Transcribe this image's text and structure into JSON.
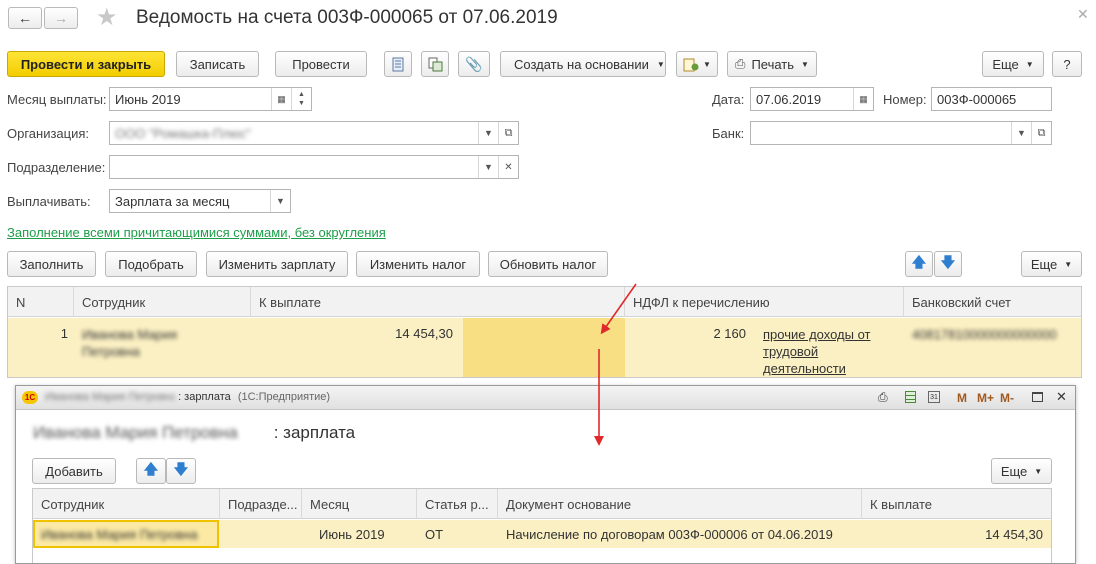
{
  "title": "Ведомость на счета 003Ф-000065 от 07.06.2019",
  "toolbar": {
    "post_close": "Провести и закрыть",
    "save": "Записать",
    "post": "Провести",
    "create_based": "Создать на основании",
    "print": "Печать",
    "more": "Еще",
    "help": "?"
  },
  "form": {
    "month_label": "Месяц выплаты:",
    "month_value": "Июнь 2019",
    "org_label": "Организация:",
    "org_value": "ООО \"Ромашка-Плюс\"",
    "dept_label": "Подразделение:",
    "dept_value": "",
    "pay_label": "Выплачивать:",
    "pay_value": "Зарплата за месяц",
    "date_label": "Дата:",
    "date_value": "07.06.2019",
    "number_label": "Номер:",
    "number_value": "003Ф-000065",
    "bank_label": "Банк:",
    "bank_value": ""
  },
  "fill_link": "Заполнение всеми причитающимися суммами, без округления",
  "actions": {
    "fill": "Заполнить",
    "pick": "Подобрать",
    "change_salary": "Изменить зарплату",
    "change_tax": "Изменить налог",
    "update_tax": "Обновить налог",
    "more": "Еще"
  },
  "table": {
    "headers": [
      "N",
      "Сотрудник",
      "К выплате",
      "НДФЛ к перечислению",
      "Банковский счет"
    ],
    "row": {
      "n": "1",
      "employee": "Иванова Мария Петровна",
      "to_pay": "14 454,30",
      "ndfl": "2 160",
      "ndfl_type": "прочие доходы от трудовой деятельности",
      "account": "40817810000000000000"
    }
  },
  "subwindow": {
    "title_blur": "Иванова Мария Петровна",
    "title_suffix": ": зарплата",
    "app_name": "(1С:Предприятие)",
    "heading_blur": "Иванова Мария Петровна",
    "heading_suffix": ": зарплата",
    "add": "Добавить",
    "more": "Еще",
    "headers": [
      "Сотрудник",
      "Подразде...",
      "Месяц",
      "Статья р...",
      "Документ основание",
      "К выплате"
    ],
    "row": {
      "employee": "Иванова Мария Петровна",
      "dept": "",
      "month": "Июнь 2019",
      "article": "ОТ",
      "doc": "Начисление по договорам 003Ф-000006 от 04.06.2019",
      "to_pay": "14 454,30"
    },
    "controls": [
      "M",
      "M+",
      "M-"
    ]
  },
  "colors": {
    "accent_yellow": "#f5d000",
    "row_highlight": "#fbf0c3",
    "cell_highlight": "#f8df83",
    "arrow": "#e0292a",
    "link_green": "#1e9e4a"
  }
}
